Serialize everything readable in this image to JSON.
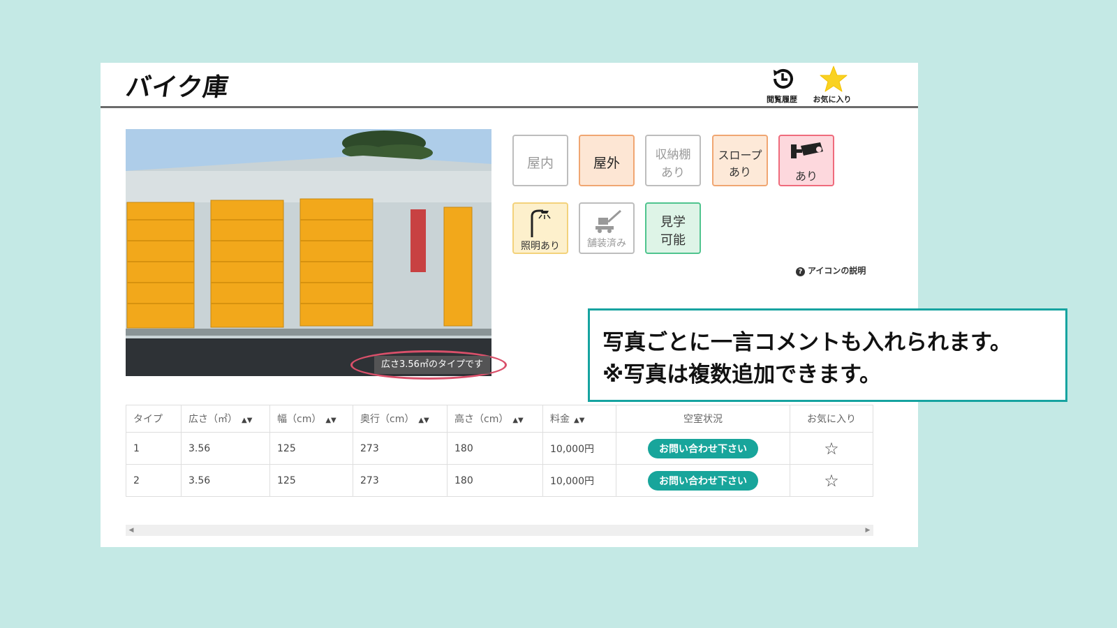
{
  "header": {
    "logo": "バイク庫",
    "history_label": "閲覧履歴",
    "favorites_label": "お気に入り"
  },
  "photo": {
    "caption": "広さ3.56㎡のタイプです"
  },
  "features": [
    {
      "id": "indoor",
      "lines": [
        "屋内"
      ]
    },
    {
      "id": "outdoor",
      "lines": [
        "屋外"
      ]
    },
    {
      "id": "shelf",
      "lines": [
        "収納棚",
        "あり"
      ]
    },
    {
      "id": "slope",
      "lines": [
        "スロープ",
        "あり"
      ]
    },
    {
      "id": "camera",
      "lines": [
        "あり"
      ]
    },
    {
      "id": "lighting",
      "lines": [
        "照明あり"
      ]
    },
    {
      "id": "paved",
      "lines": [
        "舗装済み"
      ]
    },
    {
      "id": "tour",
      "lines": [
        "見学",
        "可能"
      ]
    }
  ],
  "icon_help": "アイコンの説明",
  "callout": {
    "line1": "写真ごとに一言コメントも入れられます。",
    "line2": "※写真は複数追加できます。"
  },
  "table": {
    "headers": [
      "タイプ",
      "広さ（㎡）",
      "幅（cm）",
      "奥行（cm）",
      "高さ（cm）",
      "料金",
      "空室状況",
      "お気に入り"
    ],
    "rows": [
      {
        "type": "1",
        "area": "3.56",
        "width": "125",
        "depth": "273",
        "height": "180",
        "price": "10,000円",
        "status": "お問い合わせ下さい"
      },
      {
        "type": "2",
        "area": "3.56",
        "width": "125",
        "depth": "273",
        "height": "180",
        "price": "10,000円",
        "status": "お問い合わせ下さい"
      }
    ]
  },
  "colors": {
    "background": "#c4e9e5",
    "accent_teal": "#18a59b",
    "callout_border": "#16a3a0",
    "caption_ring": "#d9506a"
  }
}
